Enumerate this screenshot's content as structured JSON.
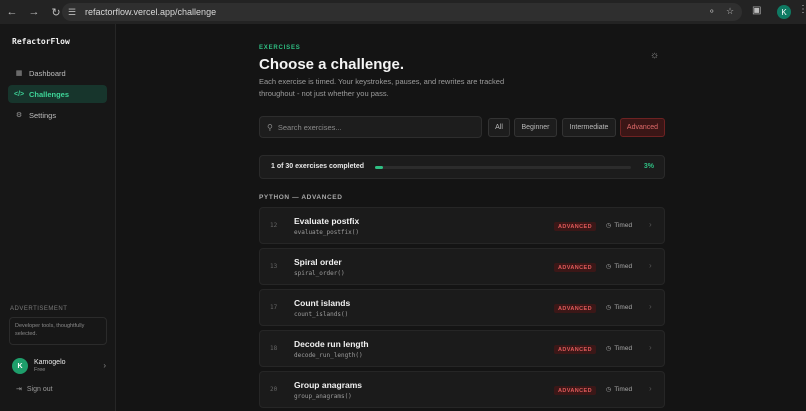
{
  "browser": {
    "url": "refactorflow.vercel.app/challenge",
    "profile_initial": "K",
    "icons": [
      "back-arrow-icon",
      "forward-arrow-icon",
      "reload-icon",
      "site-settings-icon",
      "key-icon",
      "star-icon",
      "extensions-icon",
      "more-menu-icon"
    ]
  },
  "sidebar": {
    "brand": "RefactorFlow",
    "items": [
      {
        "label": "Dashboard",
        "icon": "grid-icon"
      },
      {
        "label": "Challenges",
        "icon": "code-icon",
        "active": true
      },
      {
        "label": "Settings",
        "icon": "gear-icon"
      }
    ],
    "ad_label": "ADVERTISEMENT",
    "ad_text": "Developer tools, thoughtfully selected.",
    "user": {
      "initial": "K",
      "name": "Kamogelo",
      "plan": "Free"
    },
    "signout": "Sign out"
  },
  "main": {
    "eyebrow": "EXERCISES",
    "title": "Choose a challenge.",
    "subtitle": "Each exercise is timed. Your keystrokes, pauses, and rewrites are tracked throughout - not just whether you pass.",
    "search_placeholder": "Search exercises...",
    "filters": [
      "All",
      "Beginner",
      "Intermediate",
      "Advanced"
    ],
    "active_filter": "Advanced",
    "progress": {
      "label": "1 of 30 exercises completed",
      "percent_text": "3%",
      "fraction": 0.03
    },
    "section": "PYTHON — ADVANCED",
    "exercises": [
      {
        "num": "12",
        "name": "Evaluate postfix",
        "fn": "evaluate_postfix()",
        "badge": "ADVANCED",
        "timed": "Timed"
      },
      {
        "num": "13",
        "name": "Spiral order",
        "fn": "spiral_order()",
        "badge": "ADVANCED",
        "timed": "Timed"
      },
      {
        "num": "17",
        "name": "Count islands",
        "fn": "count_islands()",
        "badge": "ADVANCED",
        "timed": "Timed"
      },
      {
        "num": "18",
        "name": "Decode run length",
        "fn": "decode_run_length()",
        "badge": "ADVANCED",
        "timed": "Timed"
      },
      {
        "num": "20",
        "name": "Group anagrams",
        "fn": "group_anagrams()",
        "badge": "ADVANCED",
        "timed": "Timed"
      }
    ]
  },
  "colors": {
    "accent": "#2fbf83",
    "advanced": "#e05a5a",
    "background": "#141414"
  }
}
